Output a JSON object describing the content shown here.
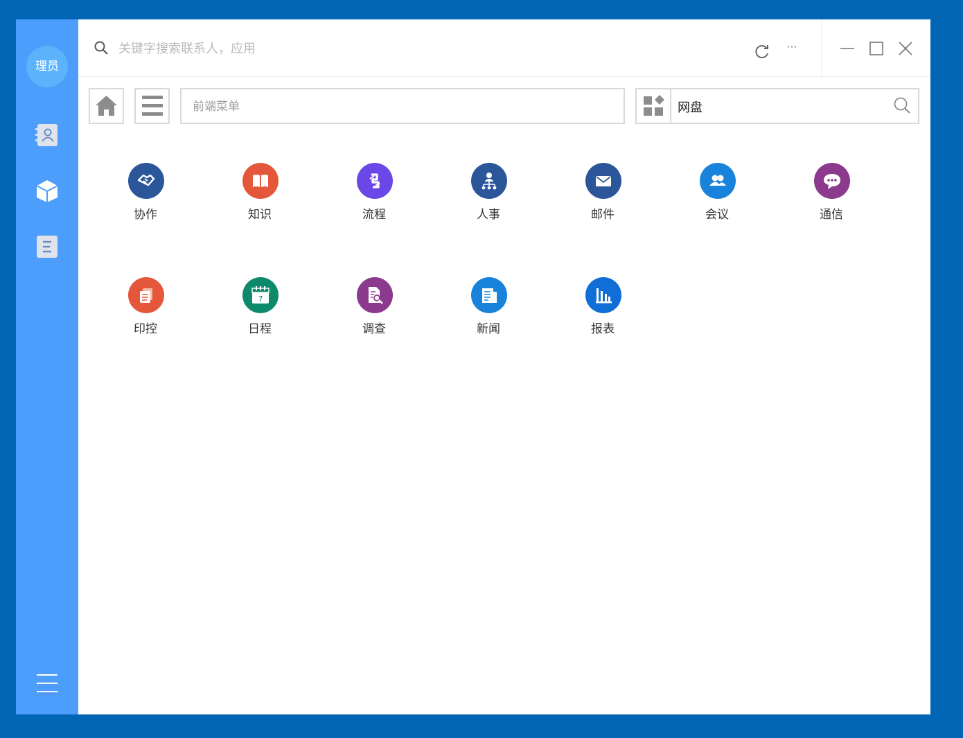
{
  "sidebar": {
    "avatar_text": "理员",
    "items": [
      {
        "name": "contacts",
        "icon": "contacts-icon"
      },
      {
        "name": "apps",
        "icon": "cube-icon"
      },
      {
        "name": "documents",
        "icon": "document-icon"
      }
    ],
    "menu_icon": "menu-icon"
  },
  "titlebar": {
    "search_placeholder": "关键字搜索联系人，应用",
    "more_label": "···"
  },
  "toolbar": {
    "menu_placeholder": "前端菜单",
    "right_search_value": "网盘"
  },
  "apps": [
    {
      "label": "协作",
      "color": "#2b579a",
      "icon": "handshake-icon"
    },
    {
      "label": "知识",
      "color": "#e4573a",
      "icon": "book-icon"
    },
    {
      "label": "流程",
      "color": "#6b47e8",
      "icon": "flow-icon"
    },
    {
      "label": "人事",
      "color": "#2b579a",
      "icon": "org-chart-icon"
    },
    {
      "label": "邮件",
      "color": "#2b579a",
      "icon": "mail-icon"
    },
    {
      "label": "会议",
      "color": "#1983db",
      "icon": "meeting-icon"
    },
    {
      "label": "通信",
      "color": "#8b3a8e",
      "icon": "chat-icon"
    },
    {
      "label": "印控",
      "color": "#e4573a",
      "icon": "seal-icon"
    },
    {
      "label": "日程",
      "color": "#0d8a6c",
      "icon": "calendar-icon"
    },
    {
      "label": "调查",
      "color": "#8b3a8e",
      "icon": "survey-icon"
    },
    {
      "label": "新闻",
      "color": "#1983db",
      "icon": "news-icon"
    },
    {
      "label": "报表",
      "color": "#0f6fd6",
      "icon": "report-icon"
    }
  ],
  "calendar_day": "7",
  "colors": {
    "background": "#0065b4",
    "sidebar": "#4c9dfc",
    "avatar": "#5db3fb"
  }
}
